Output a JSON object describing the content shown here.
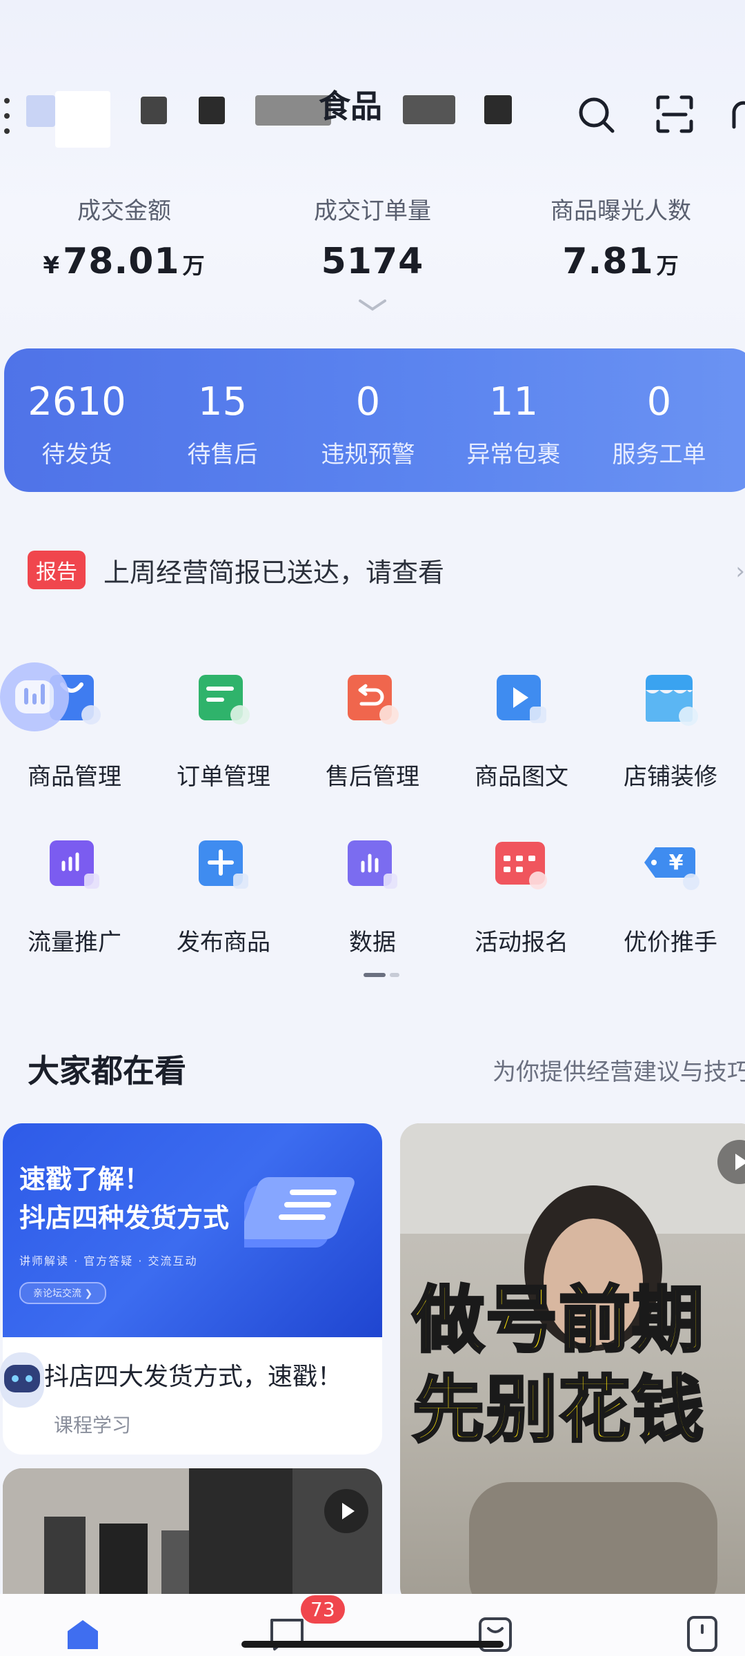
{
  "header": {
    "store_name": "食品"
  },
  "stats": [
    {
      "label": "成交金额",
      "currency": "¥",
      "value": "78.01",
      "unit": "万"
    },
    {
      "label": "成交订单量",
      "currency": "",
      "value": "5174",
      "unit": ""
    },
    {
      "label": "商品曝光人数",
      "currency": "",
      "value": "7.81",
      "unit": "万"
    }
  ],
  "summary": [
    {
      "value": "2610",
      "label": "待发货"
    },
    {
      "value": "15",
      "label": "待售后"
    },
    {
      "value": "0",
      "label": "违规预警"
    },
    {
      "value": "11",
      "label": "异常包裹"
    },
    {
      "value": "0",
      "label": "服务工单"
    }
  ],
  "notice": {
    "badge": "报告",
    "text": "上周经营简报已送达，请查看",
    "arrow": "›"
  },
  "grid": {
    "row1": [
      {
        "label": "商品管理",
        "icon": "shopping-bag-icon",
        "color": "#3f7cf0"
      },
      {
        "label": "订单管理",
        "icon": "order-list-icon",
        "color": "#2fb36b"
      },
      {
        "label": "售后管理",
        "icon": "return-icon",
        "color": "#f0664d"
      },
      {
        "label": "商品图文",
        "icon": "video-play-icon",
        "color": "#3f8cf0"
      },
      {
        "label": "店铺装修",
        "icon": "store-icon",
        "color": "#3aa3f0"
      }
    ],
    "row2": [
      {
        "label": "流量推广",
        "icon": "traffic-icon",
        "color": "#7b5cf0"
      },
      {
        "label": "发布商品",
        "icon": "plus-icon",
        "color": "#3f8cf0"
      },
      {
        "label": "数据",
        "icon": "data-chart-icon",
        "color": "#7b6cf0"
      },
      {
        "label": "活动报名",
        "icon": "calendar-icon",
        "color": "#f0555d"
      },
      {
        "label": "优价推手",
        "icon": "yen-tag-icon",
        "color": "#3f8cf0"
      }
    ]
  },
  "section": {
    "title": "大家都在看",
    "subtitle": "为你提供经营建议与技巧"
  },
  "cards": {
    "card1": {
      "banner_line1": "速戳了解！",
      "banner_line2": "抖店四种发货方式",
      "banner_line3": "讲师解读 · 官方答疑 · 交流互动",
      "banner_btn": "亲论坛交流 ❯",
      "title": "抖店四大发货方式，速戳！",
      "tag": "课程学习"
    },
    "card2": {
      "text1": "做号前期",
      "text2": "先别花钱"
    }
  },
  "bottom_nav": {
    "message_badge": "73"
  }
}
